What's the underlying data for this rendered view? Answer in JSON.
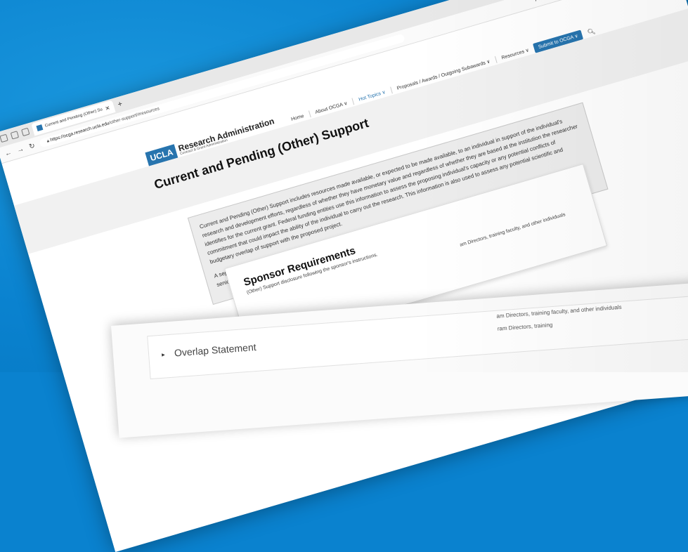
{
  "browser": {
    "tab_title": "Current and Pending (Other) Sup",
    "url_host": "https://ocga.research.ucla.edu",
    "url_path": "/other-support/#resources"
  },
  "site": {
    "logo_mark": "UCLA",
    "logo_title": "Research Administration",
    "logo_subtitle": "Contract & Grant Administration",
    "nav": {
      "home": "Home",
      "about": "About OCGA ∨",
      "hot_topics": "Hot Topics ∨",
      "proposals": "Proposals / Awards / Outgoing Subawards ∨",
      "resources": "Resources ∨",
      "submit": "Submit to OCGA ∨"
    }
  },
  "page": {
    "title": "Current and Pending (Other) Support",
    "intro_p1": "Current and Pending (Other) Support includes resources made available, or expected to be made available, to an individual in support of the individual's research and development efforts, regardless of whether they have monetary value and regardless of whether they are based at the institution the researcher identifies for the current grant. Federal funding entities use this information to assess the proposing individual's capacity or any potential conflicts of commitment that could impact the ability of the individual to carry out the research. This information is also used to assess any potential scientific and budgetary overlap of support with the proposed project.",
    "intro_p2": "A separate, up-to-date Current and Pending (Other) Support disclosure must be provided at the time required by the sponsor for each individual named as senior/key personnel.",
    "section_title": "Sponsor Requirements",
    "section_sub": "(Other) Support disclosure following the sponsor's instructions.",
    "partial_1": "am Directors, training faculty, and other individuals",
    "partial_2": "ram Directors, training",
    "overlap": "Overlap Statement"
  }
}
